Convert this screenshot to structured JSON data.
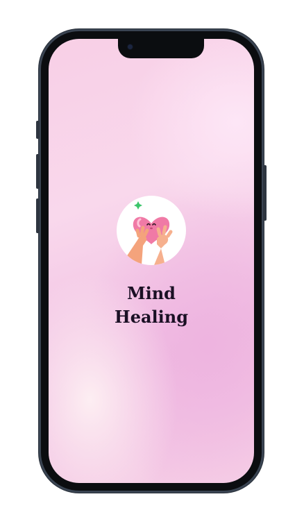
{
  "app": {
    "title_line1": "Mind",
    "title_line2": "Healing"
  },
  "icons": {
    "logo": "heart-hands-icon",
    "camera": "front-camera-icon"
  },
  "colors": {
    "title": "#1a1024",
    "background_pink": "#f0bde2",
    "heart": "#f07aa6"
  }
}
